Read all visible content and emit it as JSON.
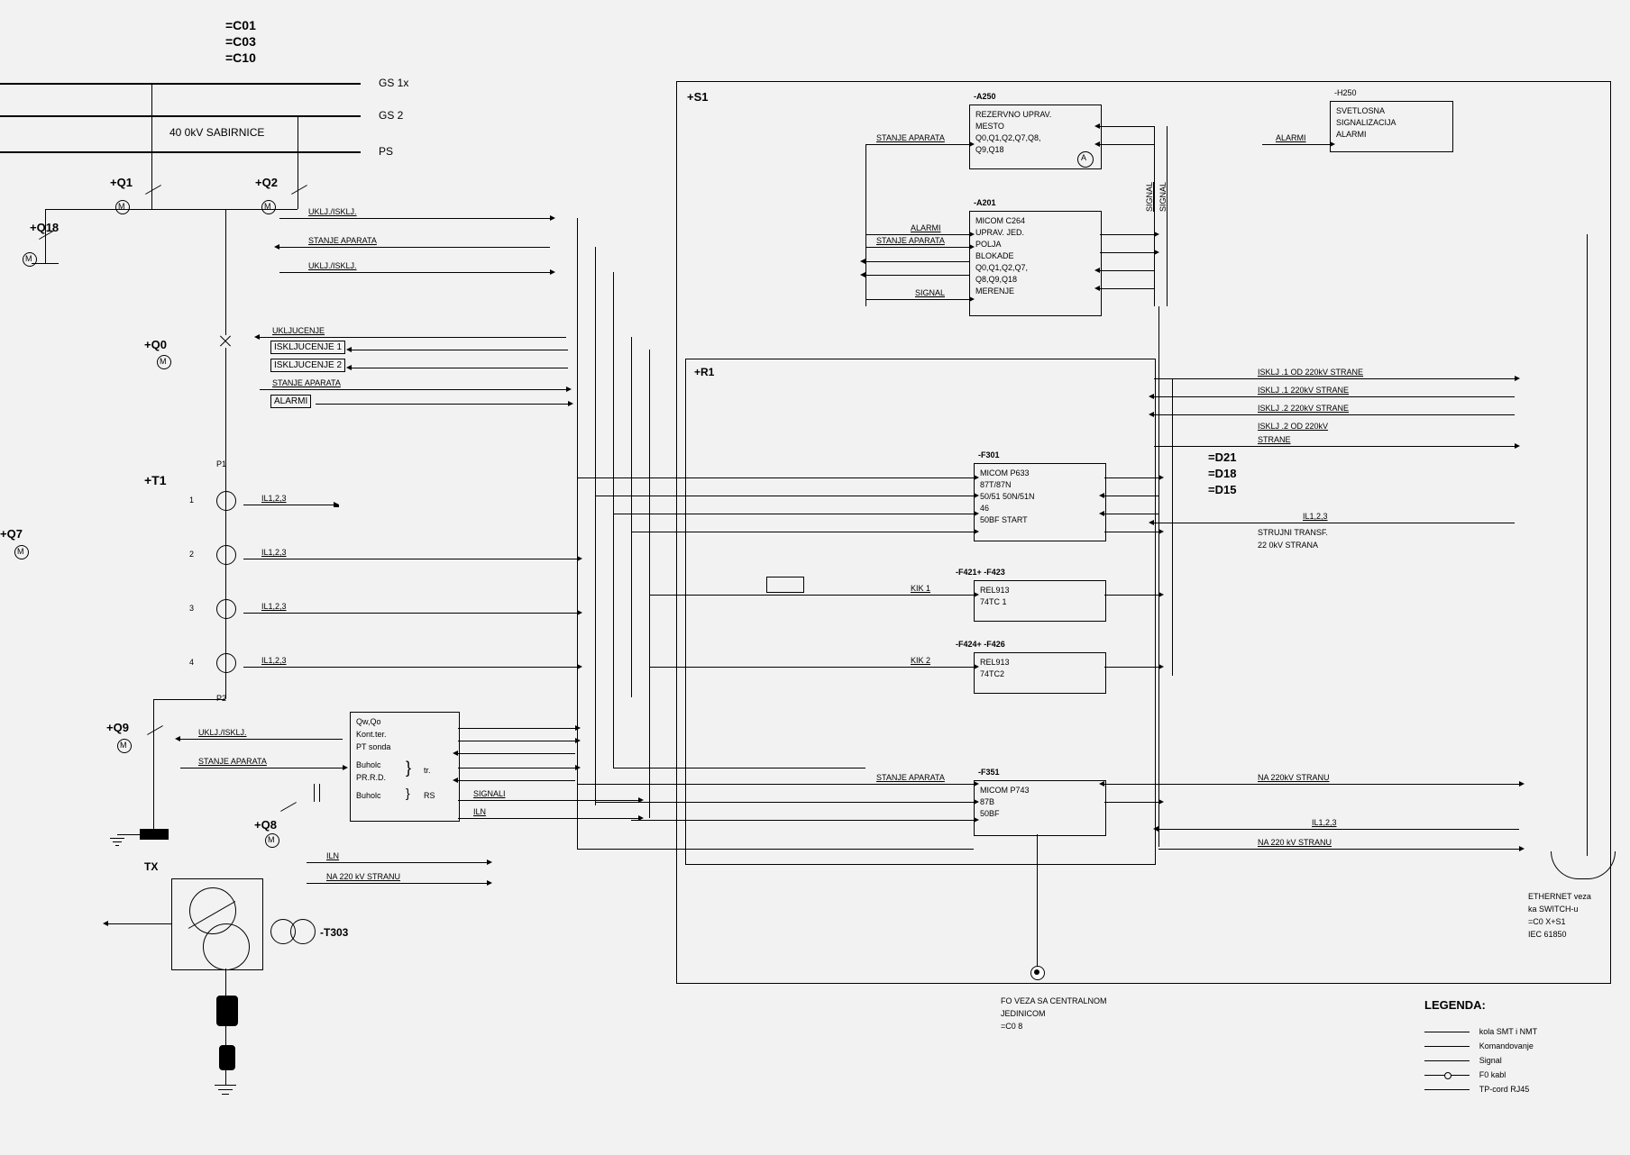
{
  "header": {
    "codes": [
      "=C01",
      "=C03",
      "=C10"
    ],
    "bus_gs1": "GS 1x",
    "bus_gs2": "GS 2",
    "bus_ps": "PS",
    "sabirnice": "40 0kV SABIRNICE"
  },
  "switches": {
    "q1": "+Q1",
    "q2": "+Q2",
    "q18": "+Q18",
    "q0": "+Q0",
    "q7": "+Q7",
    "q9": "+Q9",
    "q8": "+Q8",
    "m": "M",
    "a": "A"
  },
  "signals": {
    "uklj_isklj": "UKLJ./ISKLJ.",
    "stanje_aparata": "STANJE APARATA",
    "ukljucenje": "UKLJUCENJE",
    "iskljucenje1": "ISKLJUCENJE 1",
    "iskljucenje2": "ISKLJUCENJE 2",
    "alarmi": "ALARMI",
    "signal": "SIGNAL",
    "signali": "SIGNALI",
    "iln": "ILN",
    "na_220kv_stranu": "NA 220 kV STRANU",
    "na_220kv_stranu_u": "NA  220kV STRANU",
    "kik1": "KIK 1",
    "kik2": "KIK 2",
    "il123": "IL1,2,3",
    "strujni_transf": "STRUJNI TRANSF.",
    "strujni_transf2": "22 0kV STRANA",
    "isklj1_od": "ISKLJ .1 OD   220kV  STRANE",
    "isklj1": "ISKLJ .1   220kV  STRANE",
    "isklj2": "ISKLJ .2   220kV  STRANE",
    "isklj2_od": "ISKLJ .2 OD   220kV",
    "strane": "STRANE"
  },
  "transformer": {
    "t1": "+T1",
    "p1": "P1",
    "p2": "P2",
    "rows": [
      "1",
      "2",
      "3",
      "4"
    ],
    "il": "IL1,2,3",
    "tx": "TX",
    "t303": "-T303"
  },
  "sensor_box": {
    "lines": [
      "Qw,Qo",
      "Kont.ter.",
      "PT sonda",
      "Buholc",
      "PR.R.D.",
      "Buholc"
    ],
    "tr": "tr.",
    "rs": "RS"
  },
  "cabinet": {
    "s1": "+S1",
    "r1": "+R1"
  },
  "blocks": {
    "a250": {
      "tag": "-A250",
      "lines": [
        "REZERVNO UPRAV.",
        "MESTO",
        "Q0,Q1,Q2,Q7,Q8,",
        "Q9,Q18"
      ]
    },
    "h250": {
      "tag": "-H250",
      "lines": [
        "SVETLOSNA",
        "SIGNALIZACIJA",
        "ALARMI"
      ]
    },
    "a201": {
      "tag": "-A201",
      "lines": [
        "MICOM C264",
        "UPRAV. JED.",
        "POLJA",
        "BLOKADE",
        "Q0,Q1,Q2,Q7,",
        "Q8,Q9,Q18",
        "MERENJE"
      ]
    },
    "f301": {
      "tag": "-F301",
      "lines": [
        "MICOM P633",
        "87T/87N",
        "50/51 50N/51N",
        "46",
        "50BF START"
      ]
    },
    "f421": {
      "tag": "-F421+ -F423",
      "lines": [
        "REL913",
        "74TC 1"
      ]
    },
    "f424": {
      "tag": "-F424+ -F426",
      "lines": [
        "REL913",
        "74TC2"
      ]
    },
    "f351": {
      "tag": "-F351",
      "lines": [
        "MICOM P743",
        "87B",
        "50BF"
      ]
    }
  },
  "d_codes": [
    "=D21",
    "=D18",
    "=D15"
  ],
  "fo_veza": {
    "line1": "FO VEZA SA CENTRALNOM",
    "line2": "JEDINICOM",
    "line3": "=C0 8"
  },
  "ethernet": {
    "line1": "ETHERNET veza",
    "line2": "ka SWITCH-u",
    "line3": "=C0 X+S1",
    "line4": "IEC 61850"
  },
  "legend": {
    "title": "LEGENDA:",
    "items": [
      "kola SMT i NMT",
      "Komandovanje",
      "Signal",
      "F0 kabl",
      "TP-cord RJ45"
    ]
  }
}
